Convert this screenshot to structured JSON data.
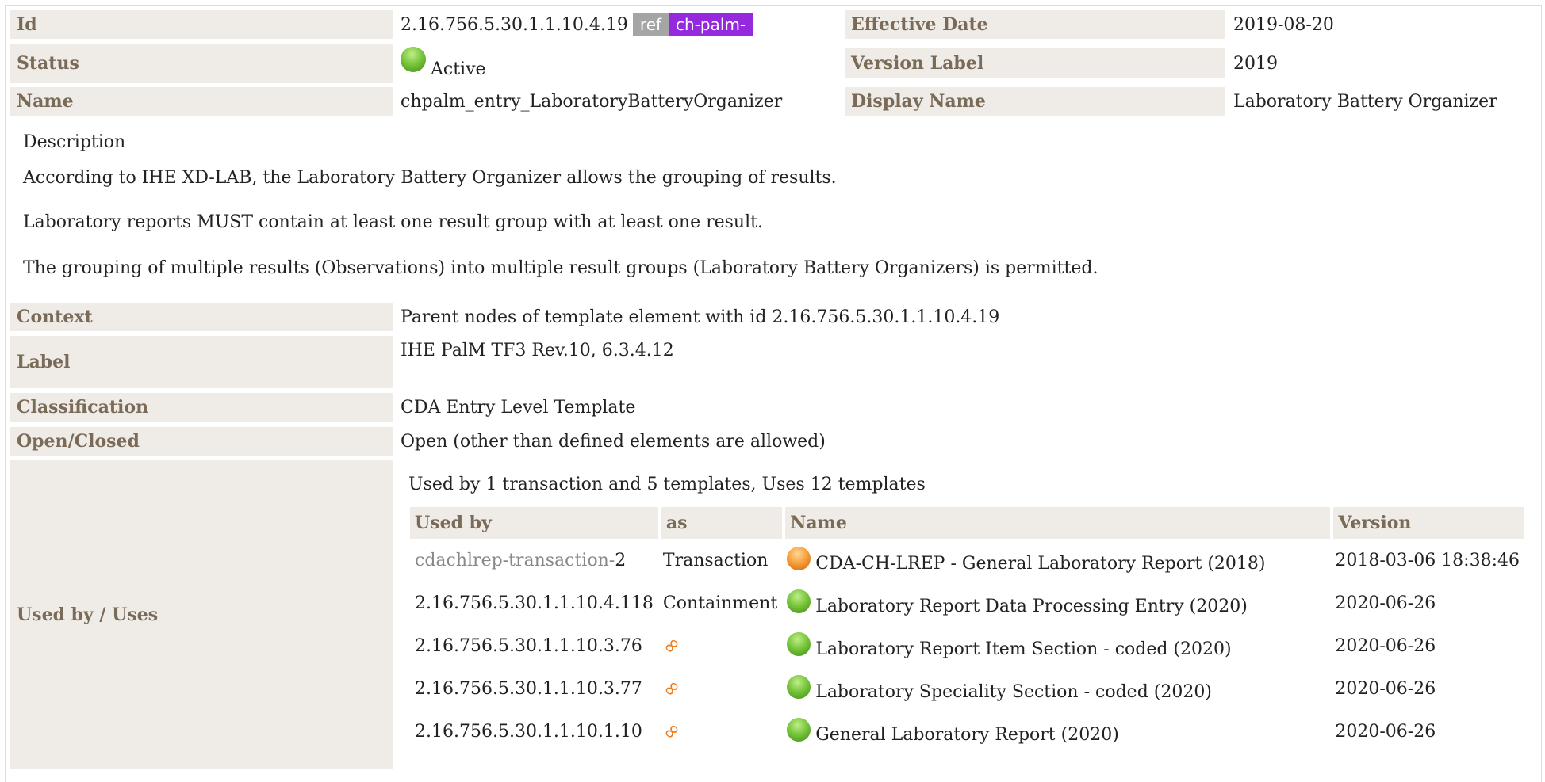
{
  "header": {
    "id_label": "Id",
    "id_value": "2.16.756.5.30.1.1.10.4.19",
    "ref_badge": "ref",
    "prefix_badge": "ch-palm-",
    "effective_date_label": "Effective Date",
    "effective_date_value": "2019-08-20",
    "status_label": "Status",
    "status_value": "Active",
    "status_color": "#79c63c",
    "version_label_label": "Version Label",
    "version_label_value": "2019",
    "name_label": "Name",
    "name_value": "chpalm_entry_LaboratoryBatteryOrganizer",
    "display_name_label": "Display Name",
    "display_name_value": "Laboratory Battery Organizer"
  },
  "description": {
    "heading": "Description",
    "paragraphs": [
      "According to IHE XD-LAB, the Laboratory Battery Organizer allows the grouping of results.",
      "Laboratory reports MUST contain at least one result group with at least one result.",
      "The grouping of multiple results (Observations) into multiple result groups (Laboratory Battery Organizers) is permitted."
    ]
  },
  "details": {
    "context_label": "Context",
    "context_value": "Parent nodes of template element with id 2.16.756.5.30.1.1.10.4.19",
    "label_label": "Label",
    "label_value": "IHE PalM TF3 Rev.10, 6.3.4.12",
    "classification_label": "Classification",
    "classification_value": "CDA Entry Level Template",
    "open_closed_label": "Open/Closed",
    "open_closed_value": "Open (other than defined elements are allowed)",
    "used_by_label": "Used by / Uses"
  },
  "usage": {
    "summary": "Used by 1 transaction and 5 templates, Uses 12 templates",
    "columns": [
      "Used by",
      "as",
      "Name",
      "Version"
    ],
    "rows": [
      {
        "id_prefix": "cdachlrep-transaction-",
        "id": "2",
        "as": "Transaction",
        "icon": "orange-status-icon",
        "name": "CDA-CH-LREP - General Laboratory Report (2018)",
        "version": "2018-03-06 18:38:46"
      },
      {
        "id_prefix": "",
        "id": "2.16.756.5.30.1.1.10.4.118",
        "as": "Containment",
        "icon": "green-status-icon",
        "name": "Laboratory Report Data Processing Entry (2020)",
        "version": "2020-06-26"
      },
      {
        "id_prefix": "",
        "id": "2.16.756.5.30.1.1.10.3.76",
        "as": "",
        "as_icon": "link-icon",
        "icon": "green-status-icon",
        "name": "Laboratory Report Item Section - coded (2020)",
        "version": "2020-06-26"
      },
      {
        "id_prefix": "",
        "id": "2.16.756.5.30.1.1.10.3.77",
        "as": "",
        "as_icon": "link-icon",
        "icon": "green-status-icon",
        "name": "Laboratory Speciality Section - coded (2020)",
        "version": "2020-06-26"
      },
      {
        "id_prefix": "",
        "id": "2.16.756.5.30.1.1.10.1.10",
        "as": "",
        "as_icon": "link-icon",
        "icon": "green-status-icon",
        "name": "General Laboratory Report (2020)",
        "version": "2020-06-26"
      }
    ]
  }
}
